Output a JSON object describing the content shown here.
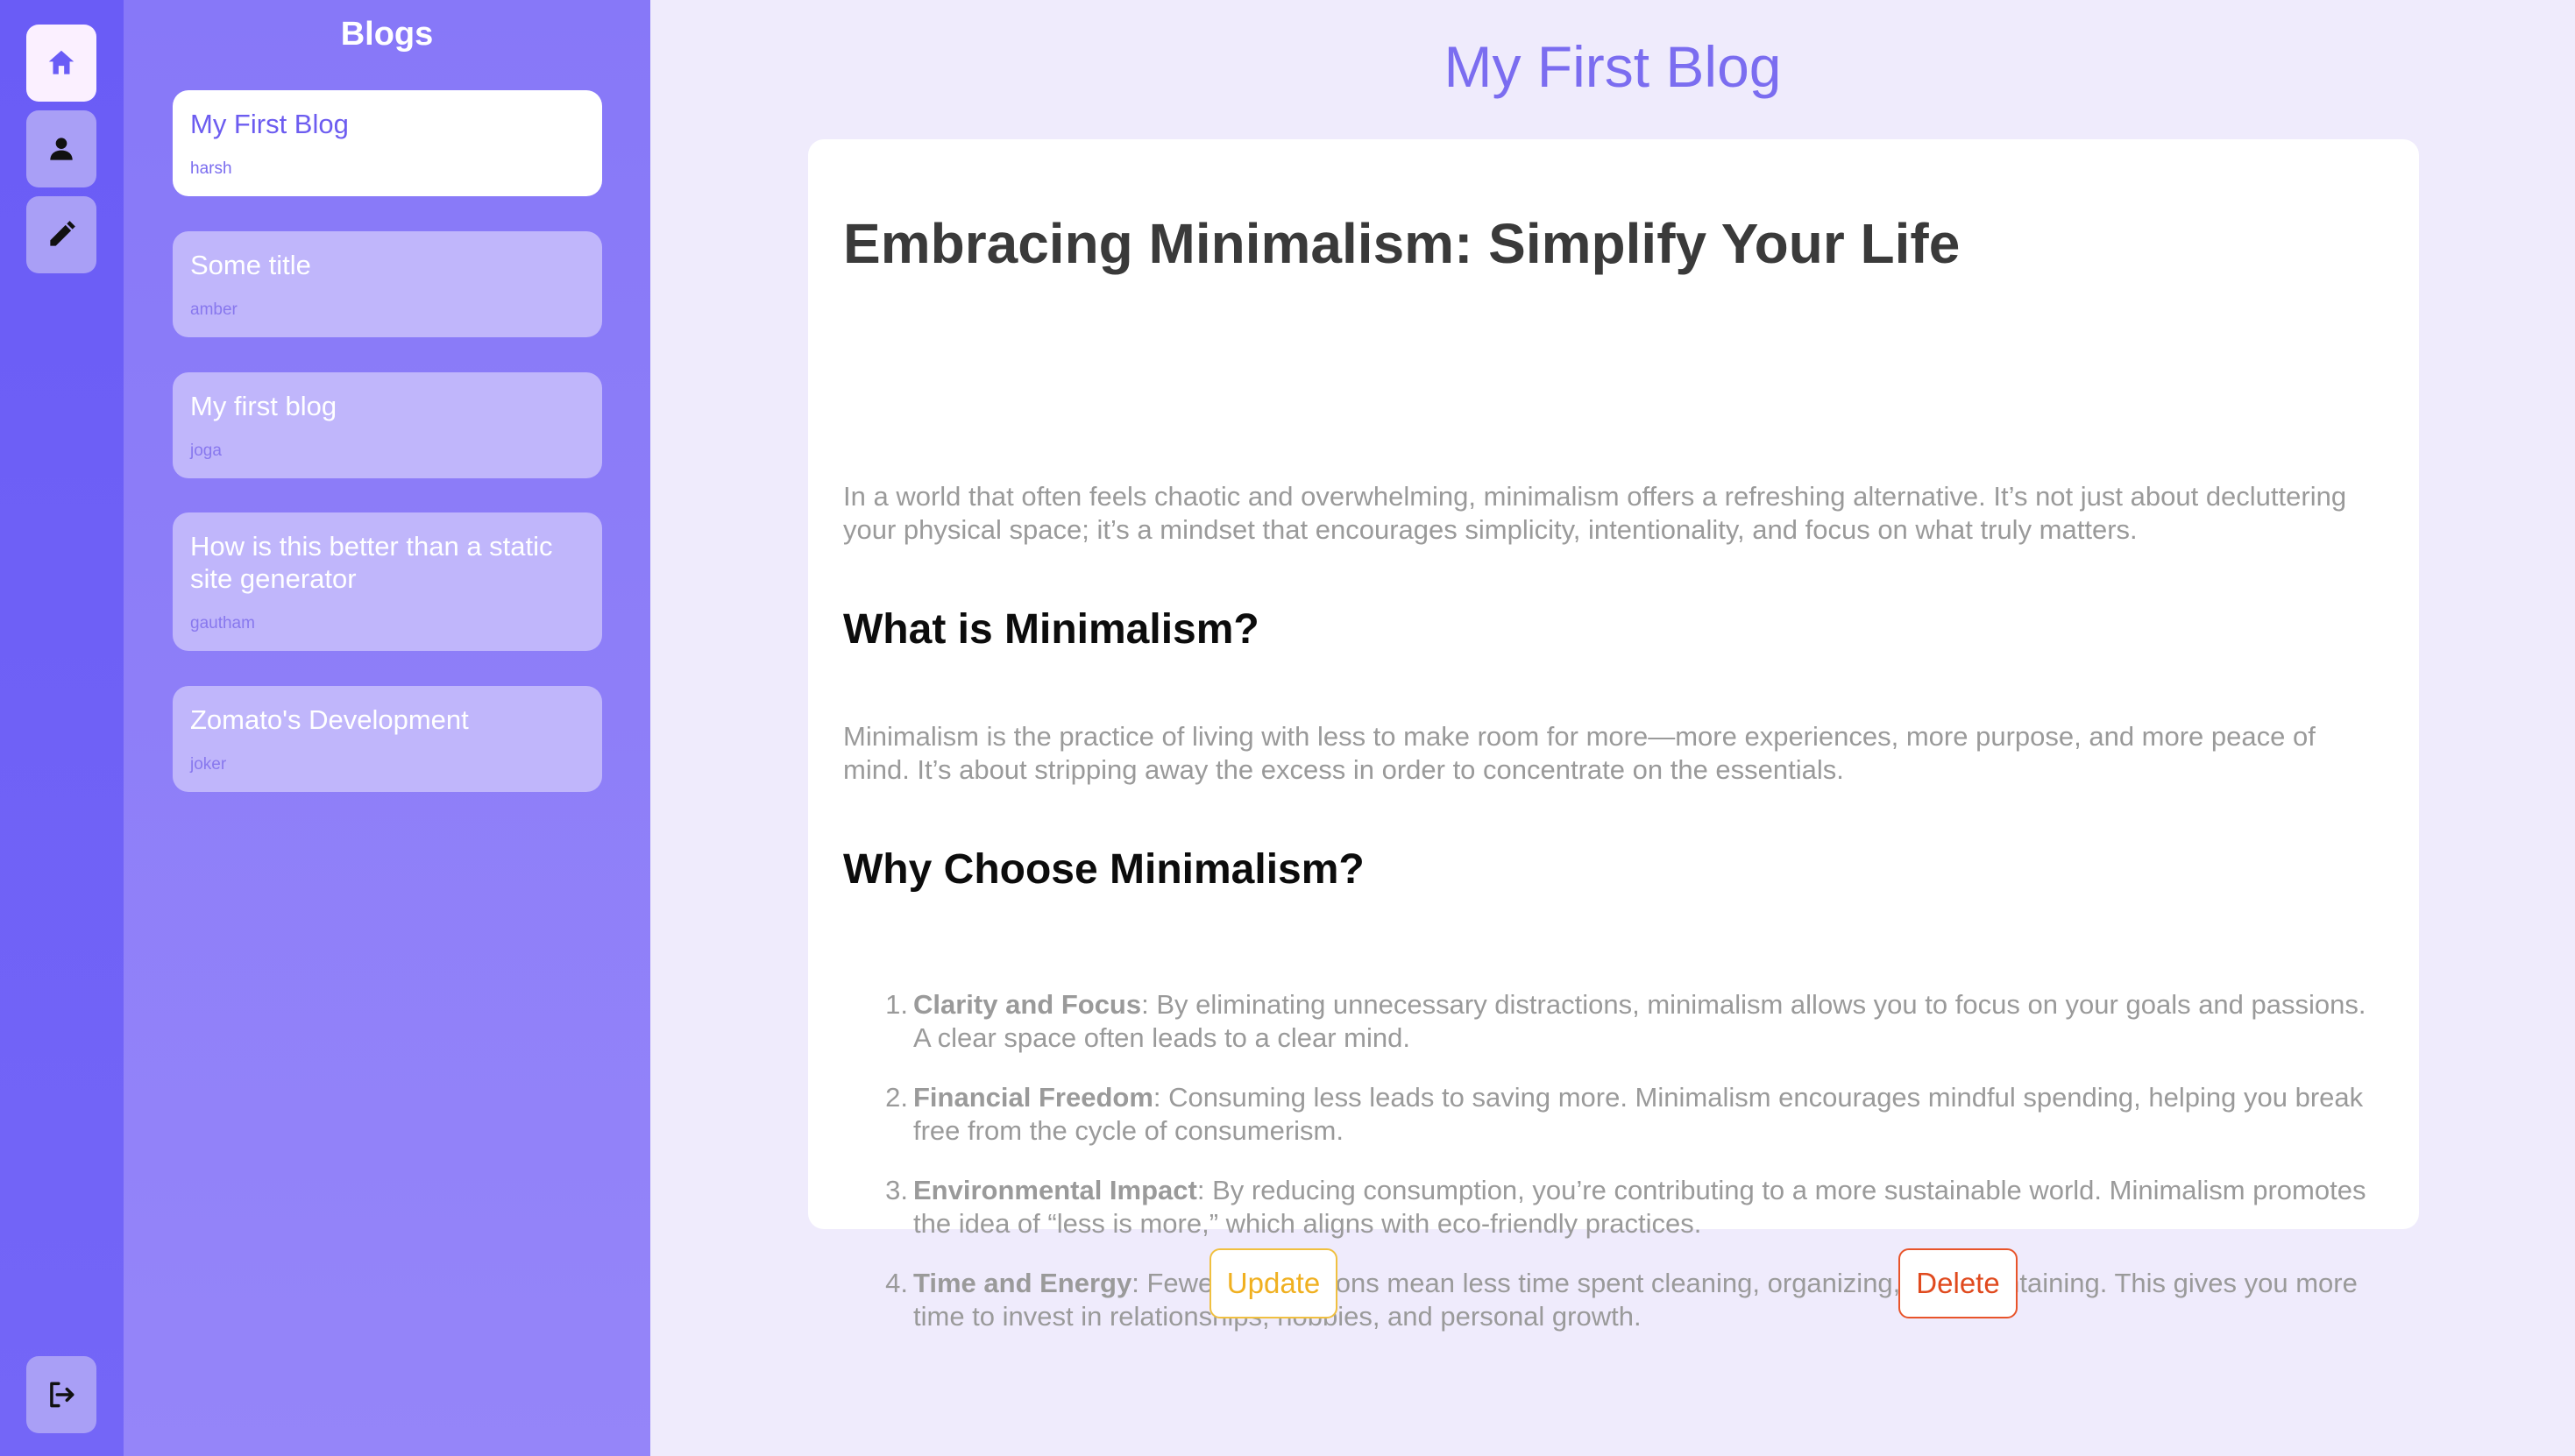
{
  "rail": {
    "items": [
      {
        "icon": "home-icon"
      },
      {
        "icon": "user-icon"
      },
      {
        "icon": "pencil-icon"
      }
    ],
    "logout_icon": "logout-icon",
    "colors": {
      "rail_bg": "#6a5cf6",
      "button_bg": "#a99ff6",
      "active_bg": "#fbf0ff"
    }
  },
  "sidebar": {
    "title": "Blogs",
    "blogs": [
      {
        "title": "My First Blog",
        "author": "harsh",
        "active": true
      },
      {
        "title": "Some title",
        "author": "amber",
        "active": false
      },
      {
        "title": "My first blog",
        "author": "joga",
        "active": false
      },
      {
        "title": "How is this better than a static site generator",
        "author": "gautham",
        "active": false
      },
      {
        "title": "Zomato's Development",
        "author": "joker",
        "active": false
      }
    ]
  },
  "main": {
    "page_title": "My First Blog",
    "article": {
      "heading": "Embracing Minimalism: Simplify Your Life",
      "intro": "In a world that often feels chaotic and overwhelming, minimalism offers a refreshing alternative. It’s not just about decluttering your physical space; it’s a mindset that encourages simplicity, intentionality, and focus on what truly matters.",
      "section1_heading": "What is Minimalism?",
      "section1_body": "Minimalism is the practice of living with less to make room for more—more experiences, more purpose, and more peace of mind. It’s about stripping away the excess in order to concentrate on the essentials.",
      "section2_heading": "Why Choose Minimalism?",
      "list": [
        {
          "num": "1.",
          "term": "Clarity and Focus",
          "text": ": By eliminating unnecessary distractions, minimalism allows you to focus on your goals and passions. A clear space often leads to a clear mind."
        },
        {
          "num": "2.",
          "term": "Financial Freedom",
          "text": ": Consuming less leads to saving more. Minimalism encourages mindful spending, helping you break free from the cycle of consumerism."
        },
        {
          "num": "3.",
          "term": "Environmental Impact",
          "text": ": By reducing consumption, you’re contributing to a more sustainable world. Minimalism promotes the idea of “less is more,” which aligns with eco-friendly practices."
        },
        {
          "num": "4.",
          "term": "Time and Energy",
          "text": ": Fewer possessions mean less time spent cleaning, organizing, and maintaining. This gives you more time to invest in relationships, hobbies, and personal growth."
        }
      ]
    },
    "actions": {
      "update_label": "Update",
      "delete_label": "Delete"
    },
    "colors": {
      "accent": "#7b6df0",
      "update": "#f0b020",
      "delete": "#e04a1e",
      "page_bg": "#efebfc"
    }
  }
}
